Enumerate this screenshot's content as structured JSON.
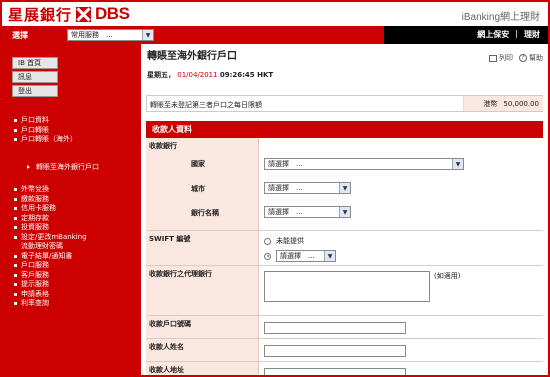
{
  "header": {
    "logo_cn": "星展銀行",
    "logo_en": "DBS",
    "brand_right": "iBanking網上理財"
  },
  "nav": {
    "select_label": "選擇",
    "select_value": "常用服務　...",
    "links": [
      "網上保安",
      "|",
      "理財"
    ]
  },
  "sidebar": {
    "buttons": [
      "IB 首頁",
      "訊息",
      "登出"
    ],
    "menu_top": [
      "戶口資料",
      "戶口轉賬",
      "戶口轉賬（海外）"
    ],
    "submenu_active": "轉賬至海外銀行戶口",
    "menu_bottom": [
      "外幣兌換",
      "繳款服務",
      "信用卡服務",
      "定期存款",
      "投資服務",
      "設定/更改mBanking",
      "流動理財密碼",
      "電子結單/通知書",
      "戶口服務",
      "客戶服務",
      "提示服務",
      "申請表格",
      "利率查詢"
    ]
  },
  "main": {
    "title": "轉賬至海外銀行戶口",
    "print_label": "列印",
    "help_label": "幫助",
    "weekday": "星期五，",
    "date": "01/04/2011",
    "time": "09:26:45 HKT",
    "limit_text": "轉賬至未登記第三者戶口之每日限額",
    "limit_currency": "港幣",
    "limit_amount": "50,000.00",
    "section_title": "收款人資料",
    "rows": {
      "bank_label": "收款銀行",
      "country_label": "國家",
      "city_label": "城市",
      "bank_name_label": "銀行名稱",
      "swift_label": "SWIFT 編號",
      "agent_label": "收款銀行之代理銀行",
      "account_label": "收款戶口號碼",
      "name_label": "收款人姓名",
      "address_label": "收款人地址"
    },
    "country_value": "請選擇　...",
    "city_value": "請選擇　...",
    "bank_name_value": "請選擇　...",
    "swift_option1": "未能提供",
    "swift_select_value": "請選擇　...",
    "if_applicable": "(如適用)"
  }
}
